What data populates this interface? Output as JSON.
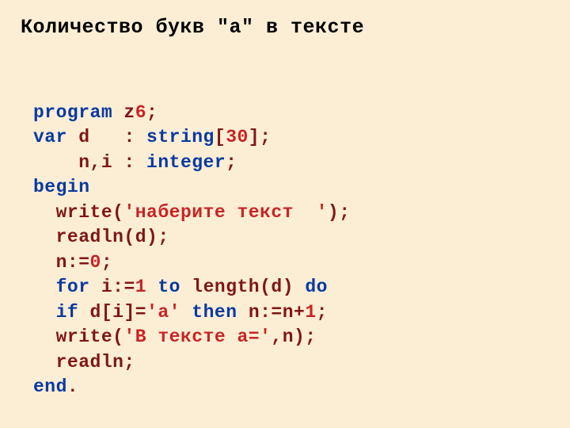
{
  "title": "Количество букв \"а\" в тексте",
  "lines": {
    "l0": {
      "k0": "program",
      "id0": " z",
      "n0": "6",
      "p0": ";"
    },
    "l1": {
      "k0": "var ",
      "id0": "d   ",
      "p0": ": ",
      "k1": "string",
      "p1": "[",
      "n0": "30",
      "p2": "];"
    },
    "l2": {
      "id0": "    n,i ",
      "p0": ": ",
      "k1": "integer",
      "p1": ";"
    },
    "l3": {
      "k0": "begin"
    },
    "l4": {
      "id0": "  write",
      "p0": "(",
      "s0": "'наберите текст  '",
      "p1": ");"
    },
    "l5": {
      "id0": "  readln",
      "p0": "(",
      "id1": "d",
      "p1": ");"
    },
    "l6": {
      "id0": "  n",
      "p0": ":=",
      "n0": "0",
      "p1": ";"
    },
    "l7": {
      "k0": "  for ",
      "id0": "i",
      "p0": ":=",
      "n0": "1",
      "k1": " to ",
      "id1": "length",
      "p1": "(",
      "id2": "d",
      "p2": ") ",
      "k2": "do"
    },
    "l8": {
      "k0": "  if ",
      "id0": "d",
      "p0": "[",
      "id1": "i",
      "p1": "]=",
      "s0": "'а'",
      "k1": " then ",
      "id2": "n",
      "p2": ":=",
      "id3": "n",
      "p3": "+",
      "n0": "1",
      "p4": ";"
    },
    "l9": {
      "id0": "  write",
      "p0": "(",
      "s0": "'В тексте а='",
      "p1": ",",
      "id1": "n",
      "p2": ");"
    },
    "l10": {
      "id0": "  readln",
      "p0": ";"
    },
    "l11": {
      "k0": "end",
      "p0": "."
    }
  }
}
